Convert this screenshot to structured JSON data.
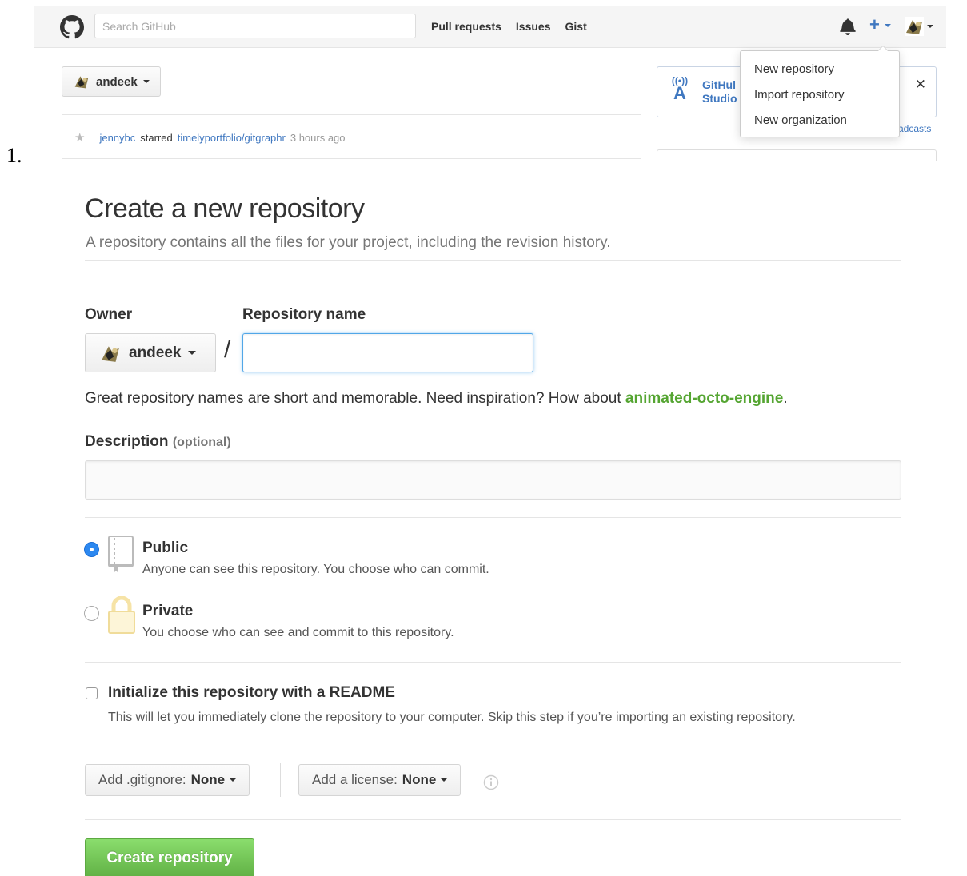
{
  "list_marker": "1.",
  "header": {
    "search_placeholder": "Search GitHub",
    "nav": [
      "Pull requests",
      "Issues",
      "Gist"
    ],
    "plus_symbol": "+"
  },
  "dashboard": {
    "context_user": "andeek",
    "feed": {
      "actor": "jennybc",
      "action": "starred",
      "repo": "timelyportfolio/gitgraphr",
      "time": "3 hours ago"
    },
    "broadcast": {
      "title_line1": "GitHul",
      "title_line2": "Studio",
      "link_partial": "adcasts"
    }
  },
  "plus_menu": {
    "items": [
      "New repository",
      "Import repository",
      "New organization"
    ]
  },
  "new_repo": {
    "title": "Create a new repository",
    "subtitle": "A repository contains all the files for your project, including the revision history.",
    "owner_label": "Owner",
    "owner_value": "andeek",
    "slash": "/",
    "repo_name_label": "Repository name",
    "repo_name_value": "",
    "suggestion_prefix": "Great repository names are short and memorable. Need inspiration? How about",
    "suggestion_name": "animated-octo-engine",
    "suggestion_suffix": ".",
    "description_label": "Description",
    "description_optional": "(optional)",
    "description_value": "",
    "visibility": {
      "selected": "Public",
      "public_title": "Public",
      "public_desc": "Anyone can see this repository. You choose who can commit.",
      "private_title": "Private",
      "private_desc": "You choose who can see and commit to this repository."
    },
    "readme": {
      "title": "Initialize this repository with a README",
      "desc": "This will let you immediately clone the repository to your computer. Skip this step if you’re importing an existing repository."
    },
    "gitignore_label": "Add .gitignore:",
    "gitignore_value": "None",
    "license_label": "Add a license:",
    "license_value": "None",
    "create_button": "Create repository"
  },
  "colors": {
    "link_blue": "#4078c0",
    "suggestion_green": "#55a532",
    "button_green": "#60b044",
    "radio_blue": "#2c88f0",
    "focus_blue": "#51a7e8"
  },
  "icons": {
    "logo": "octocat-icon",
    "bell": "bell-icon",
    "star": "star-icon",
    "broadcast": "broadcast-icon",
    "close": "close-icon",
    "public_repo": "repo-book-icon",
    "private_repo": "lock-icon",
    "info": "info-icon"
  }
}
